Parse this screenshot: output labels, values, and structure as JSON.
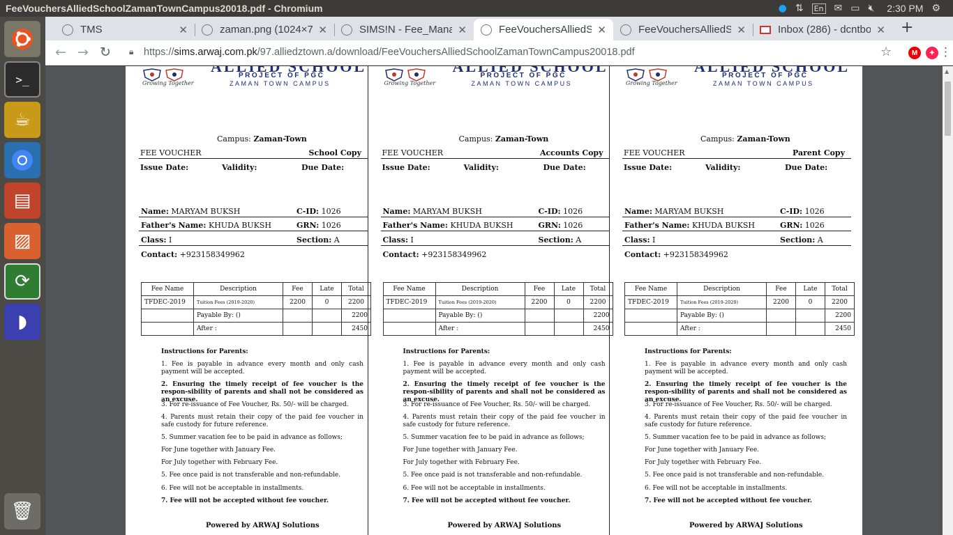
{
  "window": {
    "title": "FeeVouchersAlliedSchoolZamanTownCampus20018.pdf - Chromium"
  },
  "tray": {
    "lang": "En",
    "time": "2:30 PM"
  },
  "tabs": [
    {
      "label": "TMS"
    },
    {
      "label": "zaman.png (1024×7"
    },
    {
      "label": "SIMS!N - Fee_Manag"
    },
    {
      "label": "FeeVouchersAlliedS"
    },
    {
      "label": "FeeVouchersAlliedS"
    },
    {
      "label": "Inbox (286) - dcntbo"
    }
  ],
  "address": {
    "scheme": "https://",
    "host": "sims.arwaj.com.pk",
    "path": "/97.alliedztown.a/download/FeeVouchersAlliedSchoolZamanTownCampus20018.pdf"
  },
  "extensions": {
    "m_badge": "M"
  },
  "school": {
    "name": "ALLIED SCHOOL",
    "project": "PROJECT OF PGC",
    "campus_sub": "ZAMAN TOWN CAMPUS",
    "tagline": "Growing Together"
  },
  "voucher": {
    "campus_label": "Campus:",
    "campus_value": "Zaman-Town",
    "fee_voucher_label": "FEE VOUCHER",
    "issue_date_label": "Issue Date:",
    "validity_label": "Validity:",
    "due_date_label": "Due Date:",
    "name_label": "Name:",
    "name_value": "MARYAM BUKSH",
    "cid_label": "C-ID:",
    "cid_value": "1026",
    "father_label": "Father's Name:",
    "father_value": "KHUDA BUKSH",
    "grn_label": "GRN:",
    "grn_value": "1026",
    "class_label": "Class:",
    "class_value": "I",
    "section_label": "Section:",
    "section_value": "A",
    "contact_label": "Contact:",
    "contact_value": "+923158349962",
    "table": {
      "headers": [
        "Fee Name",
        "Description",
        "Fee",
        "Late",
        "Total"
      ],
      "row": {
        "fee_name": "TFDEC-2019",
        "description": "Tuition Fees (2019-2020)",
        "fee": "2200",
        "late": "0",
        "total": "2200"
      },
      "payable_by": "Payable By: ()",
      "payable_total": "2200",
      "after": "After :",
      "after_total": "2450"
    },
    "instructions_title": "Instructions for Parents:",
    "instructions": [
      "1.  Fee is payable in advance every month and only cash payment will be accepted.",
      "2.  Ensuring the timely receipt of fee voucher is the respon-sibility of parents and shall not be considered as an excuse.",
      "3. For re-issuance of Fee Voucher, Rs. 50/- will be charged.",
      "4.  Parents must retain their copy of the paid fee voucher in safe custody for future reference.",
      "5. Summer vacation fee to be paid in advance as follows;",
      "For June together with January Fee.",
      "For July together with February Fee.",
      "5. Fee once paid is not transferable and non-refundable.",
      "6. Fee will not be acceptable in installments.",
      "7. Fee will not be accepted without fee voucher."
    ],
    "powered_by": "Powered by ARWAJ Solutions"
  },
  "copies": [
    {
      "type": "School Copy"
    },
    {
      "type": "Accounts Copy"
    },
    {
      "type": "Parent Copy"
    }
  ],
  "colors": {
    "navy": "#1f2d73",
    "panel": "#3c3b37",
    "tabstrip": "#dee1e6",
    "pdf_bg": "#525659"
  }
}
